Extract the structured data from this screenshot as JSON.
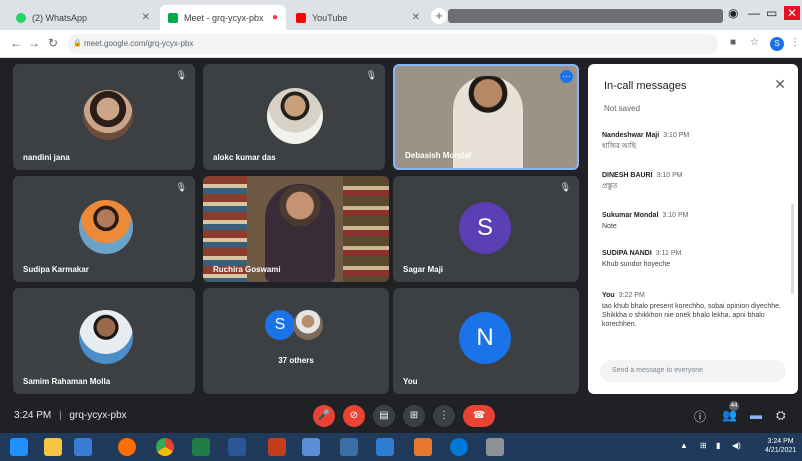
{
  "browser": {
    "tabs": [
      {
        "label": "(2) WhatsApp",
        "favicon_color": "#25d366",
        "active": false
      },
      {
        "label": "Meet - grq-ycyx-pbx",
        "favicon_color": "#00ac47",
        "active": true
      },
      {
        "label": "YouTube",
        "favicon_color": "#ff0000",
        "active": false
      }
    ],
    "address": "meet.google.com/grq-ycyx-pbx",
    "profile_initial": "S"
  },
  "participants": [
    {
      "name": "nandini jana",
      "kind": "photo"
    },
    {
      "name": "alokc kumar das",
      "kind": "photo"
    },
    {
      "name": "Debasish Mondal",
      "kind": "video",
      "speaking": true
    },
    {
      "name": "Sudipa Karmakar",
      "kind": "photo"
    },
    {
      "name": "Ruchira Goswami",
      "kind": "video"
    },
    {
      "name": "Sagar Maji",
      "kind": "letter",
      "letter": "S",
      "color": "#5b3fb5"
    },
    {
      "name": "Samim Rahaman Molla",
      "kind": "photo"
    },
    {
      "name": "37 others",
      "kind": "group",
      "letter": "S",
      "color": "#1a73e8"
    },
    {
      "name": "You",
      "kind": "letter",
      "letter": "N",
      "color": "#1a73e8"
    }
  ],
  "chat": {
    "title": "In-call messages",
    "note": "Not saved",
    "messages": [
      {
        "sender": "Nandeshwar Maji",
        "time": "3:10 PM",
        "text": "হাজির আছি"
      },
      {
        "sender": "DINESH BAURI",
        "time": "3:10 PM",
        "text": "প্রস্তুত"
      },
      {
        "sender": "Sukumar Mondal",
        "time": "3:10 PM",
        "text": "Note"
      },
      {
        "sender": "SUDIPA NANDI",
        "time": "3:11 PM",
        "text": "Khub sundor hoyeche"
      },
      {
        "sender": "You",
        "time": "3:22 PM",
        "text": "tao khub bhalo present korechho, sobai opinion diyechhe. Shikkha o shikkhon nie onek bhalo lekha. apni bhalo korechhen."
      }
    ],
    "input_placeholder": "Send a message to everyone"
  },
  "meeting": {
    "time": "3:24 PM",
    "separator": "|",
    "code": "grq-ycyx-pbx",
    "people_count": "44"
  },
  "taskbar": {
    "clock_time": "3:24 PM",
    "clock_date": "4/21/2021"
  }
}
